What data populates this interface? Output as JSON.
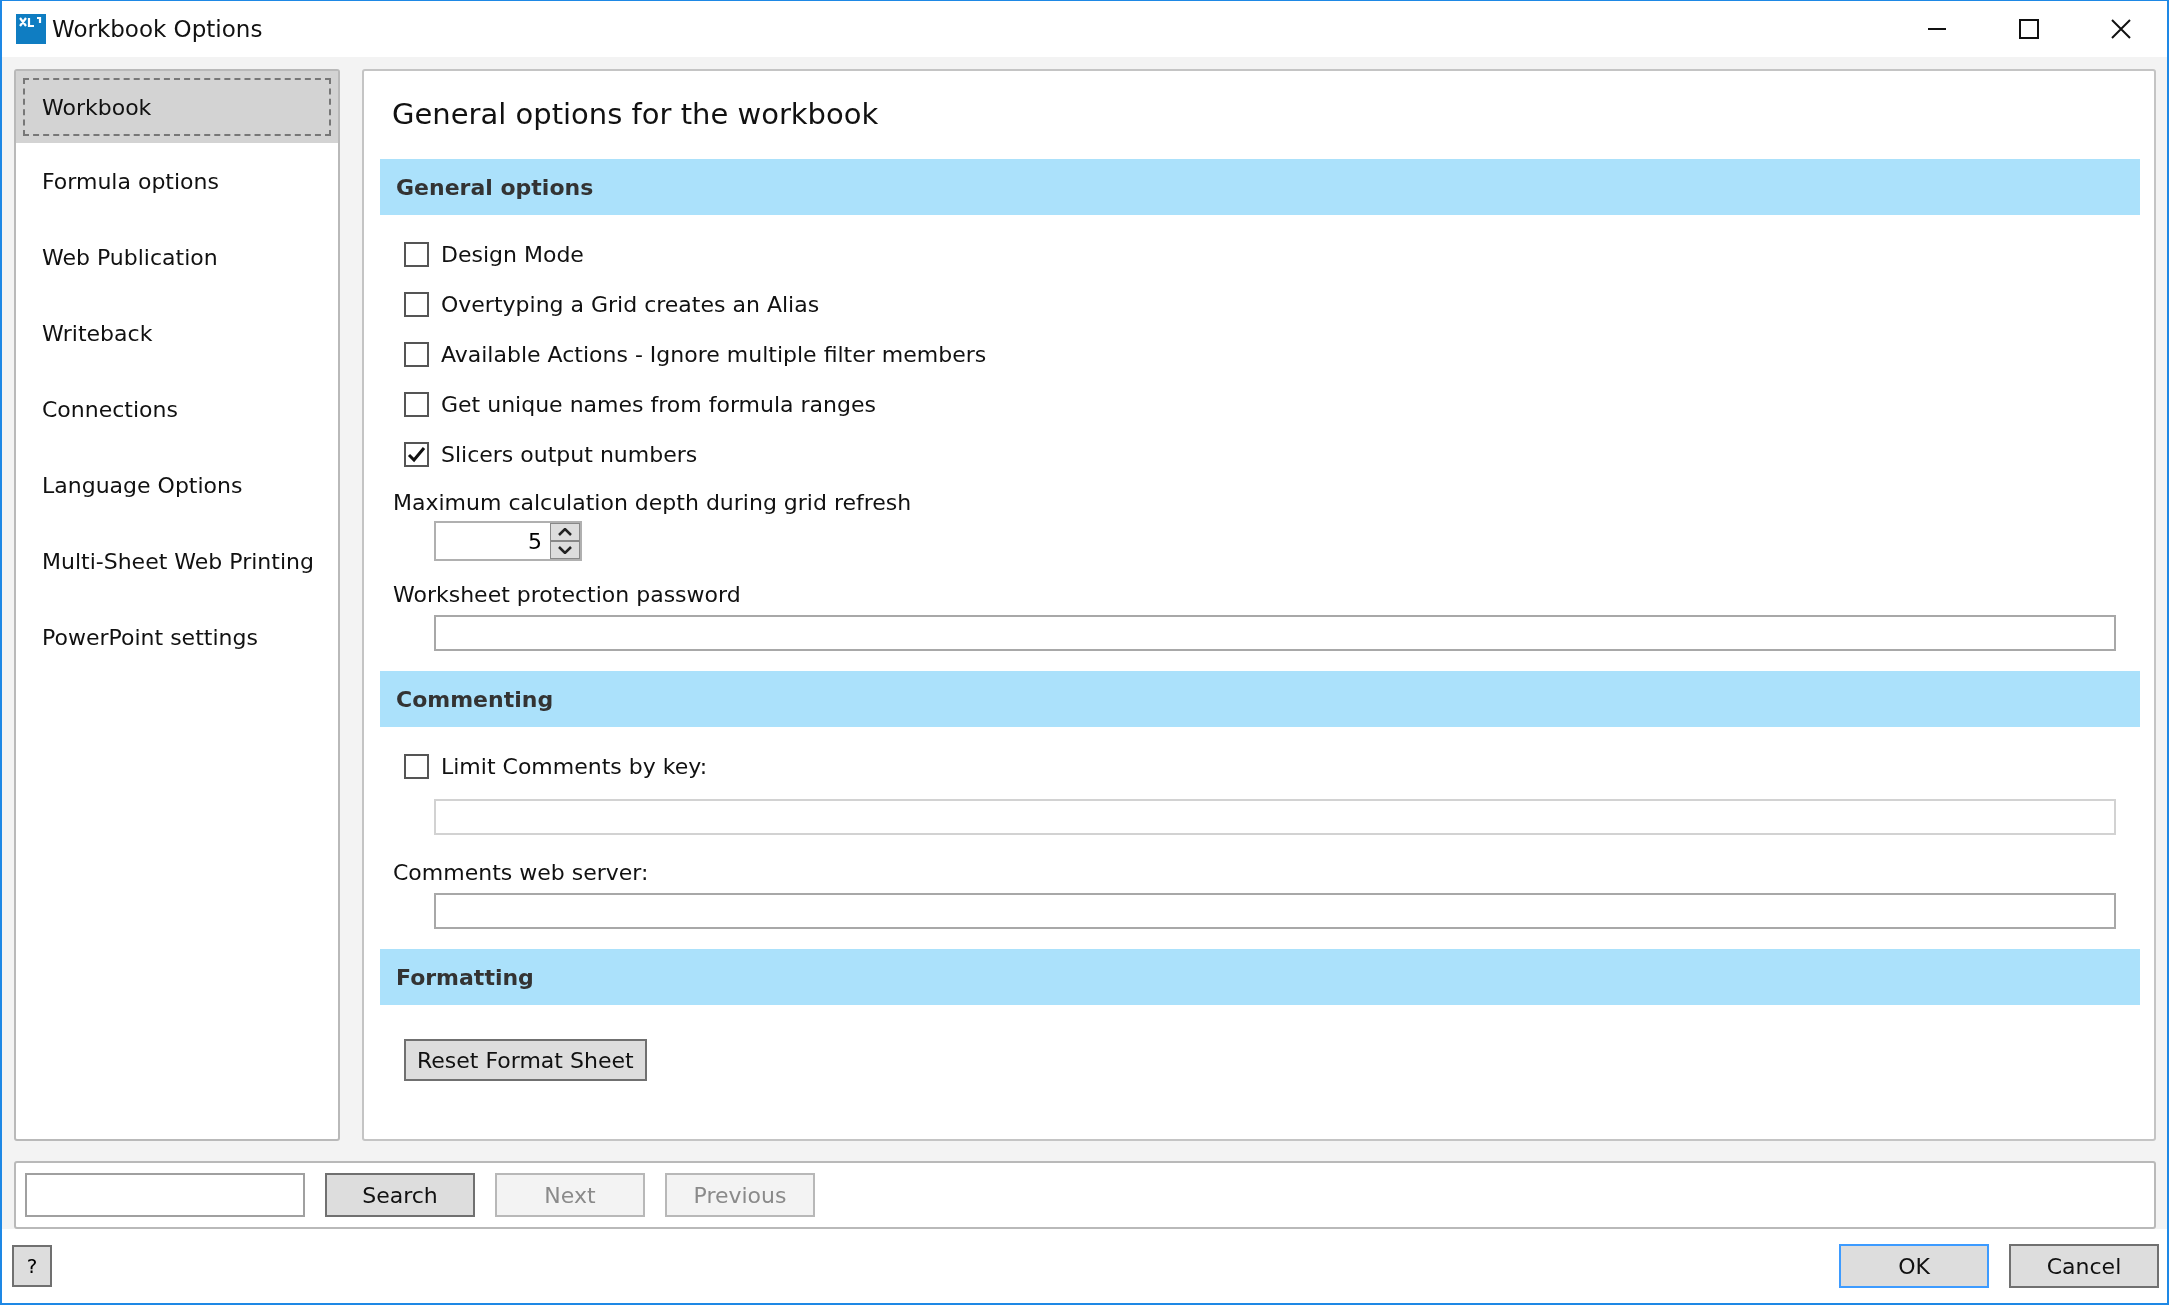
{
  "window": {
    "title": "Workbook Options"
  },
  "sidebar": {
    "items": [
      {
        "label": "Workbook",
        "selected": true
      },
      {
        "label": "Formula options",
        "selected": false
      },
      {
        "label": "Web Publication",
        "selected": false
      },
      {
        "label": "Writeback",
        "selected": false
      },
      {
        "label": "Connections",
        "selected": false
      },
      {
        "label": "Language Options",
        "selected": false
      },
      {
        "label": "Multi-Sheet Web Printing",
        "selected": false
      },
      {
        "label": "PowerPoint settings",
        "selected": false
      }
    ]
  },
  "page_title": "General options for the workbook",
  "sections": [
    {
      "heading": "General options",
      "items": [
        {
          "kind": "checkbox",
          "label": "Design Mode",
          "checked": false
        },
        {
          "kind": "checkbox",
          "label": "Overtyping a Grid creates an Alias",
          "checked": false
        },
        {
          "kind": "checkbox",
          "label": "Available Actions - Ignore multiple filter members",
          "checked": false
        },
        {
          "kind": "checkbox",
          "label": "Get unique names from formula ranges",
          "checked": false
        },
        {
          "kind": "checkbox",
          "label": "Slicers output numbers",
          "checked": true
        },
        {
          "kind": "spinner",
          "label": "Maximum calculation depth during grid refresh",
          "value": "5"
        },
        {
          "kind": "text_field",
          "label": "Worksheet protection password",
          "disabled": false
        }
      ]
    },
    {
      "heading": "Commenting",
      "items": [
        {
          "kind": "checkbox",
          "label": "Limit Comments by key:",
          "checked": false
        },
        {
          "kind": "text_field",
          "disabled": true
        },
        {
          "kind": "text_field",
          "label": "Comments web server:",
          "disabled": false
        }
      ]
    },
    {
      "heading": "Formatting",
      "items": [
        {
          "kind": "button",
          "label": "Reset Format Sheet"
        }
      ]
    }
  ],
  "search_bar": {
    "buttons": [
      {
        "label": "Search",
        "disabled": false
      },
      {
        "label": "Next",
        "disabled": true
      },
      {
        "label": "Previous",
        "disabled": true
      }
    ]
  },
  "footer": {
    "help": "?",
    "buttons": [
      {
        "label": "OK",
        "default": true
      },
      {
        "label": "Cancel",
        "default": false
      }
    ]
  }
}
